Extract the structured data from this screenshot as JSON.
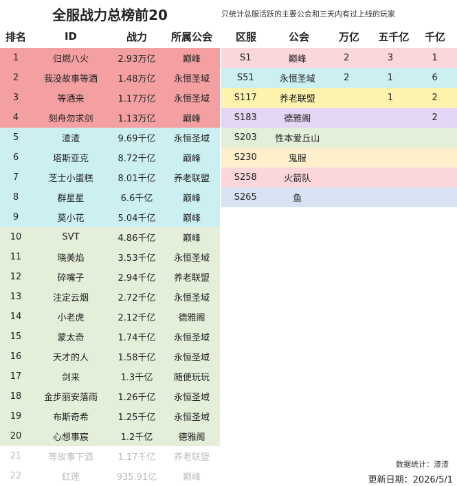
{
  "title": "全服战力总榜前20",
  "subtitle": "只统计总服活跃的主要公会和三天内有过上线的玩家",
  "left_headers": [
    "排名",
    "ID",
    "战力",
    "所属公会"
  ],
  "right_headers": [
    "区服",
    "公会",
    "万亿",
    "五千亿",
    "千亿"
  ],
  "colors": {
    "red": "#f4a0a2",
    "cyan": "#ccf0f2",
    "green": "#e3efd9",
    "pink": "#fbd7dc",
    "yellow": "#fdf3ad",
    "purple": "#e3d5f3",
    "peach": "#fff0cc",
    "blue": "#d7e2f3",
    "faded_text": "#bdbdbd"
  },
  "ranking": [
    {
      "rank": "1",
      "id": "归燃八火",
      "power": "2.93万亿",
      "guild": "巅峰",
      "color": "red"
    },
    {
      "rank": "2",
      "id": "我没故事等酒",
      "power": "1.48万亿",
      "guild": "永恒圣域",
      "color": "red"
    },
    {
      "rank": "3",
      "id": "等酒来",
      "power": "1.17万亿",
      "guild": "永恒圣域",
      "color": "red"
    },
    {
      "rank": "4",
      "id": "刻舟勿求剑",
      "power": "1.13万亿",
      "guild": "巅峰",
      "color": "red"
    },
    {
      "rank": "5",
      "id": "渣渣",
      "power": "9.69千亿",
      "guild": "永恒圣域",
      "color": "cyan"
    },
    {
      "rank": "6",
      "id": "塔斯亚克",
      "power": "8.72千亿",
      "guild": "巅峰",
      "color": "cyan"
    },
    {
      "rank": "7",
      "id": "芝士小蛋糕",
      "power": "8.01千亿",
      "guild": "养老联盟",
      "color": "cyan"
    },
    {
      "rank": "8",
      "id": "群星星",
      "power": "6.6千亿",
      "guild": "巅峰",
      "color": "cyan"
    },
    {
      "rank": "9",
      "id": "莫小花",
      "power": "5.04千亿",
      "guild": "巅峰",
      "color": "cyan"
    },
    {
      "rank": "10",
      "id": "SVT",
      "power": "4.86千亿",
      "guild": "巅峰",
      "color": "green"
    },
    {
      "rank": "11",
      "id": "晓美焰",
      "power": "3.53千亿",
      "guild": "永恒圣域",
      "color": "green"
    },
    {
      "rank": "12",
      "id": "碎嘴子",
      "power": "2.94千亿",
      "guild": "养老联盟",
      "color": "green"
    },
    {
      "rank": "13",
      "id": "注定云烟",
      "power": "2.72千亿",
      "guild": "永恒圣域",
      "color": "green"
    },
    {
      "rank": "14",
      "id": "小老虎",
      "power": "2.12千亿",
      "guild": "德雅阁",
      "color": "green"
    },
    {
      "rank": "15",
      "id": "蒙太奇",
      "power": "1.74千亿",
      "guild": "永恒圣域",
      "color": "green"
    },
    {
      "rank": "16",
      "id": "天才的人",
      "power": "1.58千亿",
      "guild": "永恒圣域",
      "color": "green"
    },
    {
      "rank": "17",
      "id": "剑来",
      "power": "1.3千亿",
      "guild": "随便玩玩",
      "color": "green"
    },
    {
      "rank": "18",
      "id": "金步丽安落雨",
      "power": "1.26千亿",
      "guild": "永恒圣域",
      "color": "green"
    },
    {
      "rank": "19",
      "id": "布斯奇希",
      "power": "1.25千亿",
      "guild": "永恒圣域",
      "color": "green"
    },
    {
      "rank": "20",
      "id": "心想事宸",
      "power": "1.2千亿",
      "guild": "德雅阁",
      "color": "green"
    },
    {
      "rank": "21",
      "id": "等故事下酒",
      "power": "1.17千亿",
      "guild": "养老联盟",
      "color": "none",
      "faded": true
    },
    {
      "rank": "22",
      "id": "红莲",
      "power": "935.91亿",
      "guild": "巅峰",
      "color": "none",
      "faded": true
    }
  ],
  "servers": [
    {
      "server": "S1",
      "guild": "巅峰",
      "wanyi": "2",
      "wuqianyi": "3",
      "qianyi": "1",
      "color": "pink"
    },
    {
      "server": "S51",
      "guild": "永恒圣域",
      "wanyi": "2",
      "wuqianyi": "1",
      "qianyi": "6",
      "color": "cyan"
    },
    {
      "server": "S117",
      "guild": "养老联盟",
      "wanyi": "",
      "wuqianyi": "1",
      "qianyi": "2",
      "color": "yellow"
    },
    {
      "server": "S183",
      "guild": "德雅阁",
      "wanyi": "",
      "wuqianyi": "",
      "qianyi": "2",
      "color": "purple"
    },
    {
      "server": "S203",
      "guild": "性本爱丘山",
      "wanyi": "",
      "wuqianyi": "",
      "qianyi": "",
      "color": "green"
    },
    {
      "server": "S230",
      "guild": "鬼服",
      "wanyi": "",
      "wuqianyi": "",
      "qianyi": "",
      "color": "peach"
    },
    {
      "server": "S258",
      "guild": "火箭队",
      "wanyi": "",
      "wuqianyi": "",
      "qianyi": "",
      "color": "pink"
    },
    {
      "server": "S265",
      "guild": "鱼",
      "wanyi": "",
      "wuqianyi": "",
      "qianyi": "",
      "color": "blue"
    }
  ],
  "footer": {
    "stats_by": "数据统计：渣渣",
    "update_date": "更新日期：2026/5/1"
  }
}
